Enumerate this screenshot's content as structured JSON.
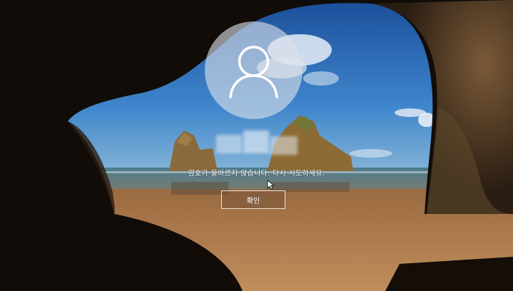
{
  "login": {
    "user_icon": "user-icon",
    "error_message": "암호가 올바르지 않습니다. 다시 시도하세요.",
    "ok_button_label": "확인"
  },
  "colors": {
    "sky": "#2a6fbf",
    "sea": "#3f6f86",
    "sand": "#b07a4a",
    "cave": "#0f0b08",
    "rock": "#6a4c2f"
  }
}
